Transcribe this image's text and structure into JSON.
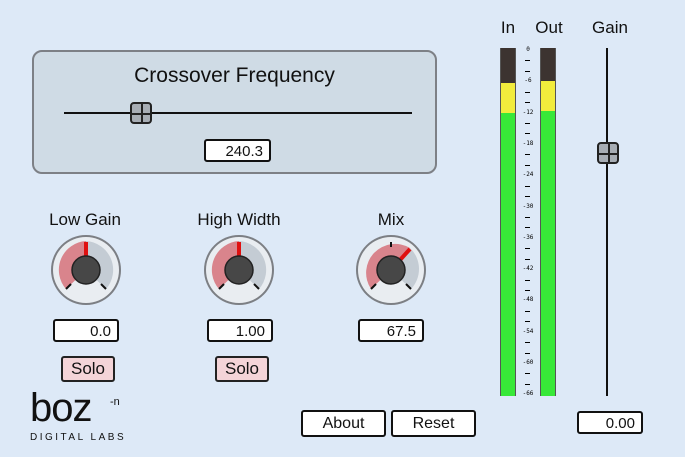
{
  "crossover": {
    "title": "Crossover Frequency",
    "value": "240.3",
    "slider_position": 0.22
  },
  "knobs": [
    {
      "label": "Low Gain",
      "value": "0.0",
      "level": 0.5,
      "solo_label": "Solo"
    },
    {
      "label": "High Width",
      "value": "1.00",
      "level": 0.5,
      "solo_label": "Solo"
    },
    {
      "label": "Mix",
      "value": "67.5",
      "level": 0.675
    }
  ],
  "meters": {
    "in_label": "In",
    "out_label": "Out",
    "gain_label": "Gain",
    "scale": [
      "0",
      "-6",
      "-12",
      "-18",
      "-24",
      "-30",
      "-36",
      "-42",
      "-48",
      "-54",
      "-60",
      "-66"
    ],
    "gain_value": "0.00",
    "gain_slider_position": 0.3,
    "colors": {
      "green": "#38e838",
      "yellow": "#f2ec3c",
      "dark": "#3c3330"
    }
  },
  "buttons": {
    "about": "About",
    "reset": "Reset"
  },
  "logo": {
    "text": "boz",
    "superscript": "-n",
    "subtitle": "DIGITAL LABS"
  },
  "colors": {
    "background": "#dde9f7",
    "panel": "#cfdbe5",
    "knob_red": "#d9848c",
    "knob_grey": "#c4ccd4",
    "solo_pink": "#f4d4d8"
  }
}
